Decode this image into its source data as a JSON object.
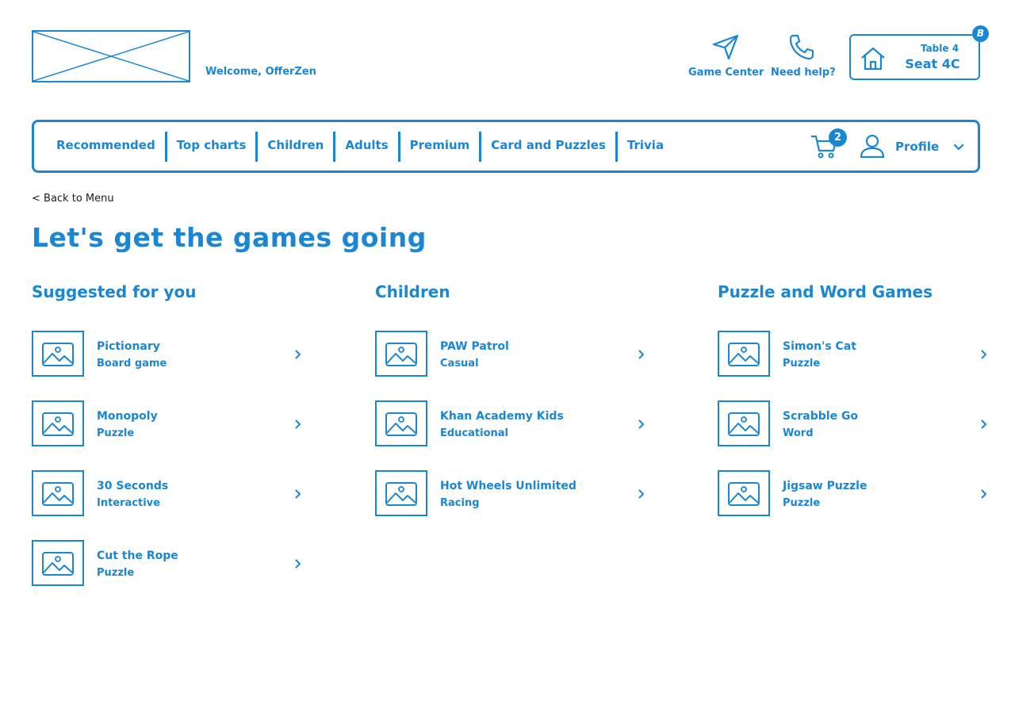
{
  "header": {
    "welcome": "Welcome, OfferZen",
    "game_center_label": "Game Center",
    "need_help_label": "Need help?",
    "table_label": "Table 4",
    "seat_label": "Seat 4C",
    "seat_badge": "B"
  },
  "nav": {
    "tabs": [
      {
        "label": "Recommended"
      },
      {
        "label": "Top charts"
      },
      {
        "label": "Children"
      },
      {
        "label": "Adults"
      },
      {
        "label": "Premium"
      },
      {
        "label": "Card and Puzzles"
      },
      {
        "label": "Trivia"
      }
    ],
    "cart_count": "2",
    "profile_label": "Profile"
  },
  "back_link": "< Back to Menu",
  "page_title": "Let's get the games going",
  "sections": [
    {
      "title": "Suggested for you",
      "items": [
        {
          "name": "Pictionary",
          "category": "Board game"
        },
        {
          "name": "Monopoly",
          "category": "Puzzle"
        },
        {
          "name": "30 Seconds",
          "category": "Interactive"
        },
        {
          "name": "Cut the Rope",
          "category": "Puzzle"
        }
      ]
    },
    {
      "title": "Children",
      "items": [
        {
          "name": "PAW Patrol",
          "category": "Casual"
        },
        {
          "name": "Khan Academy Kids",
          "category": "Educational"
        },
        {
          "name": "Hot Wheels Unlimited",
          "category": "Racing"
        }
      ]
    },
    {
      "title": "Puzzle and Word Games",
      "items": [
        {
          "name": "Simon's Cat",
          "category": "Puzzle"
        },
        {
          "name": "Scrabble Go",
          "category": "Word"
        },
        {
          "name": "Jigsaw Puzzle",
          "category": "Puzzle"
        }
      ]
    }
  ],
  "icons": {
    "game_center": "paper-plane-icon",
    "need_help": "phone-icon",
    "seat": "home-icon",
    "cart": "cart-icon",
    "profile": "user-icon",
    "profile_dropdown": "chevron-down-icon",
    "game_thumb": "image-placeholder-icon",
    "game_open": "chevron-right-icon"
  },
  "colors": {
    "accent": "#1a86d4",
    "text_dark": "#1a1a1a",
    "background": "#ffffff"
  }
}
